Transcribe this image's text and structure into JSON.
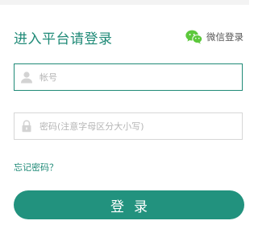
{
  "header": {
    "title": "进入平台请登录",
    "wechat_login_label": "微信登录"
  },
  "form": {
    "account": {
      "placeholder": "帐号",
      "value": "",
      "icon": "user-icon"
    },
    "password": {
      "placeholder": "密码(注意字母区分大小写)",
      "value": "",
      "icon": "lock-icon"
    },
    "forgot_password": "忘记密码？",
    "submit_label": "登录"
  },
  "colors": {
    "accent": "#1f8a77",
    "button": "#22927e",
    "wechat_icon": "#5cc83b"
  }
}
